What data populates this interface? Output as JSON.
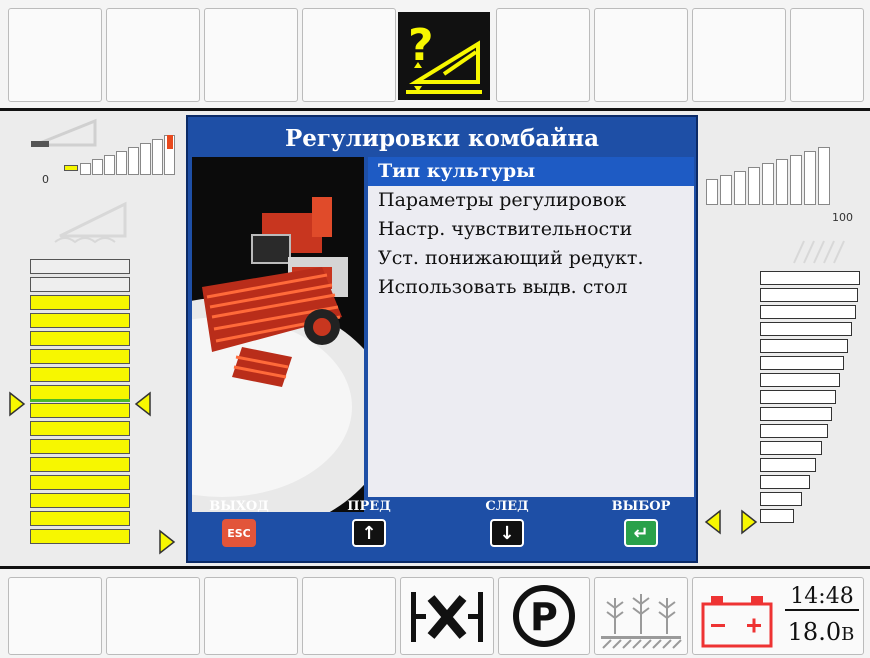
{
  "dialog": {
    "title": "Регулировки комбайна",
    "menu": [
      "Тип культуры",
      "Параметры регулировок",
      "Настр. чувствительности",
      "Уст. понижающий редукт.",
      "Использовать выдв. стол"
    ],
    "softkeys": [
      {
        "label": "ВЫХОД",
        "key": "ESC"
      },
      {
        "label": "ПРЕД",
        "key": "↑"
      },
      {
        "label": "СЛЕД",
        "key": "↓"
      },
      {
        "label": "ВЫБОР",
        "key": "↵"
      }
    ]
  },
  "left_gauge": {
    "min_label": "0"
  },
  "right_gauge": {
    "max_label": "100"
  },
  "status": {
    "time": "14:48",
    "voltage": "18.0",
    "voltage_unit": "В"
  },
  "colors": {
    "accent_blue": "#1e4fa6",
    "warning_yellow": "#f7f700",
    "esc_red": "#e2553a",
    "enter_green": "#2aa14a"
  }
}
